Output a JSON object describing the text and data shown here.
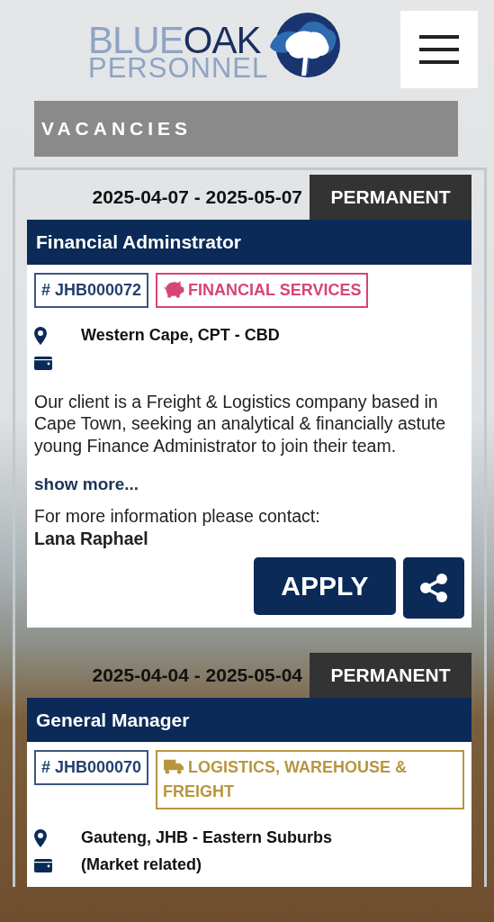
{
  "logo": {
    "word_light": "BLUE",
    "word_dark": "OAK",
    "word_bottom": "PERSONNEL"
  },
  "section_title": "VACANCIES",
  "jobs": [
    {
      "dates": "2025-04-07 - 2025-05-07",
      "type": "PERMANENT",
      "title": "Financial Adminstrator",
      "reference": "# JHB000072",
      "category": {
        "label": "FINANCIAL SERVICES",
        "kind": "piggy-bank",
        "color": "#d6457a"
      },
      "location": "Western Cape, CPT - CBD",
      "description": "Our client is a Freight & Logistics company based in Cape Town, seeking an analytical & financially astute young Finance Administrator to join their team.",
      "show_more": "show more...",
      "contact_label": "For more information please contact:",
      "contact_name": "Lana Raphael",
      "apply": "APPLY"
    },
    {
      "dates": "2025-04-04 - 2025-05-04",
      "type": "PERMANENT",
      "title": "General Manager",
      "reference": "# JHB000070",
      "category": {
        "label": "LOGISTICS, WAREHOUSE & FREIGHT",
        "kind": "truck",
        "color": "#b8963e"
      },
      "location": "Gauteng, JHB - Eastern Suburbs",
      "salary": "(Market related)"
    }
  ]
}
